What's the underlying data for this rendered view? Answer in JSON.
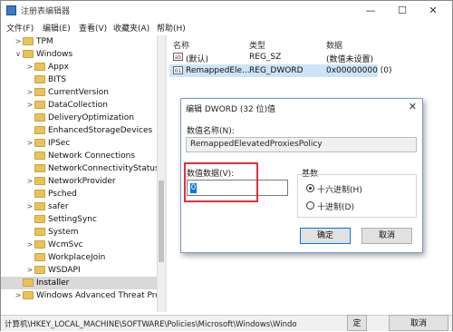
{
  "window": {
    "title": "注册表编辑器",
    "min": "—",
    "max": "☐",
    "close": "✕"
  },
  "menu": [
    "文件(F)",
    "编辑(E)",
    "查看(V)",
    "收藏夹(A)",
    "帮助(H)"
  ],
  "tree": [
    {
      "label": "TPM",
      "expand": ">"
    },
    {
      "label": "Windows",
      "expand": "∨"
    },
    {
      "label": "Appx",
      "expand": ">"
    },
    {
      "label": "BITS",
      "expand": ""
    },
    {
      "label": "CurrentVersion",
      "expand": ">"
    },
    {
      "label": "DataCollection",
      "expand": ">"
    },
    {
      "label": "DeliveryOptimization",
      "expand": ""
    },
    {
      "label": "EnhancedStorageDevices",
      "expand": ""
    },
    {
      "label": "IPSec",
      "expand": ">"
    },
    {
      "label": "Network Connections",
      "expand": ""
    },
    {
      "label": "NetworkConnectivityStatusInc",
      "expand": ""
    },
    {
      "label": "NetworkProvider",
      "expand": ">"
    },
    {
      "label": "Psched",
      "expand": ""
    },
    {
      "label": "safer",
      "expand": ">"
    },
    {
      "label": "SettingSync",
      "expand": ""
    },
    {
      "label": "System",
      "expand": ""
    },
    {
      "label": "WcmSvc",
      "expand": ">"
    },
    {
      "label": "WorkplaceJoin",
      "expand": ""
    },
    {
      "label": "WSDAPI",
      "expand": ">"
    },
    {
      "label": "Installer",
      "expand": ""
    },
    {
      "label": "Windows Advanced Threat Prote",
      "expand": ">"
    }
  ],
  "values_pane": {
    "headers": {
      "name": "名称",
      "type": "类型",
      "data": "数据"
    },
    "rows": [
      {
        "name": "(默认)",
        "type": "REG_SZ",
        "data": "(数值未设置)"
      },
      {
        "name": "RemappedEle...",
        "type": "REG_DWORD",
        "data": "0x00000000 (0)"
      }
    ]
  },
  "status": "计算机\\HKEY_LOCAL_MACHINE\\SOFTWARE\\Policies\\Microsoft\\Windows\\Windo",
  "bg_buttons": {
    "ok": "定",
    "cancel": "取消"
  },
  "dialog": {
    "title": "编辑 DWORD (32 位)值",
    "close": "✕",
    "value_name_label": "数值名称(N):",
    "value_name": "RemappedElevatedProxiesPolicy",
    "value_data_label": "数值数据(V):",
    "value_data": "0",
    "base_label": "基数",
    "hex_label": "十六进制(H)",
    "dec_label": "十进制(D)",
    "selected_base": "hex",
    "ok_label": "确定",
    "cancel_label": "取消"
  },
  "colors": {
    "accent": "#0078d7",
    "highlight": "#e0303a",
    "selection": "#cce4f7"
  }
}
